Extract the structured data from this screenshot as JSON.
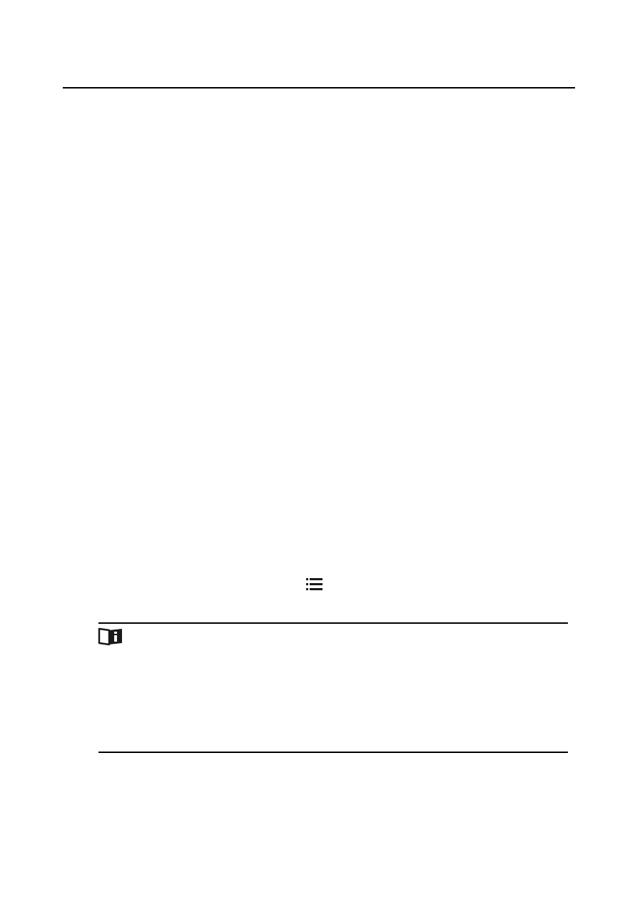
{
  "icons": {
    "inline_icon": "list-icon",
    "note_icon": "note-book-info-icon"
  },
  "colors": {
    "rule": "#000000",
    "icon_fill": "#1a1a1a",
    "background": "#ffffff"
  }
}
